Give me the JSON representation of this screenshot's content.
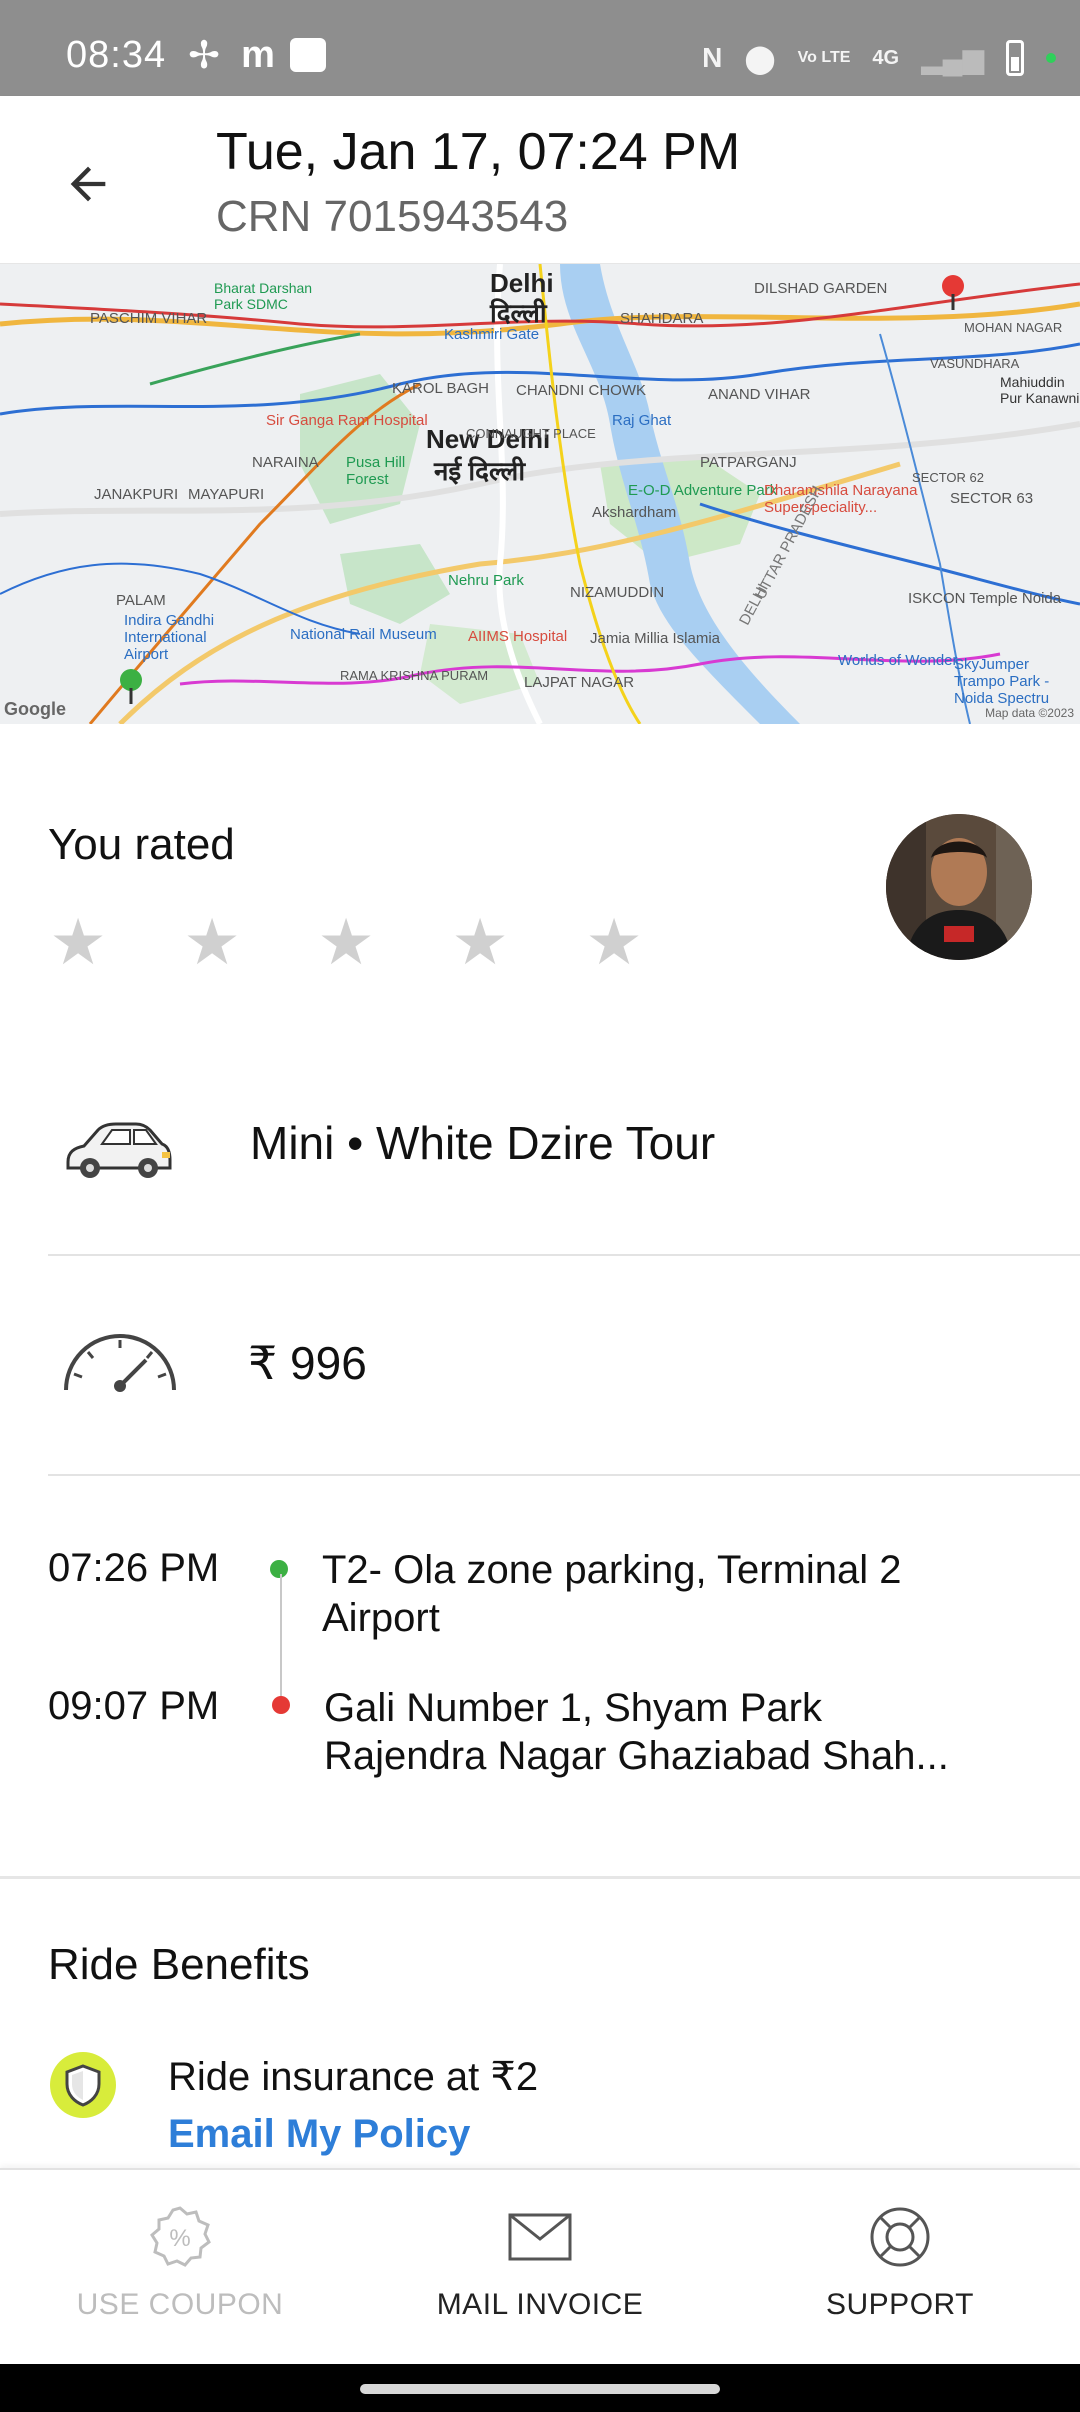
{
  "status_bar": {
    "time": "08:34",
    "signal_label": "4G",
    "volte_label": "Vo LTE"
  },
  "header": {
    "title": "Tue, Jan 17, 07:24 PM",
    "crn": "CRN 7015943543"
  },
  "map": {
    "labels": {
      "delhi_en": "Delhi",
      "delhi_hi": "दिल्ली",
      "new_delhi_en": "New Delhi",
      "new_delhi_hi": "नई दिल्ली",
      "paschim_vihar": "PASCHIM VIHAR",
      "shahdara": "SHAHDARA",
      "dilshad_garden": "DILSHAD GARDEN",
      "karol_bagh": "KAROL BAGH",
      "chandni_chowk": "CHANDNI CHOWK",
      "connaught_place": "CONNAUGHT PLACE",
      "anand_vihar": "ANAND VIHAR",
      "patparganj": "PATPARGANJ",
      "naraina": "NARAINA",
      "janakpuri": "JANAKPURI",
      "mayapuri": "MAYAPURI",
      "palam": "PALAM",
      "nizamuddin": "NIZAMUDDIN",
      "lajpat_nagar": "LAJPAT NAGAR",
      "rama_krishna_puram": "RAMA KRISHNA PURAM",
      "sector_62": "SECTOR 62",
      "sector_63": "SECTOR 63",
      "mohan_nagar": "MOHAN NAGAR",
      "vasundhara": "VASUNDHARA",
      "mahiuddin": "Mahiuddin Pur Kanawni",
      "bharat_darshan": "Bharat Darshan Park SDMC",
      "kashmiri_gate": "Kashmiri Gate",
      "raj_ghat": "Raj Ghat",
      "sir_ganga_ram": "Sir Ganga Ram Hospital",
      "pusa_hill": "Pusa Hill Forest",
      "akshardham": "Akshardham",
      "eod_park": "E-O-D Adventure Park",
      "dharamshila": "Dharamshila Narayana Superspeciality...",
      "nehru_park": "Nehru Park",
      "national_rail_museum": "National Rail Museum",
      "aiims": "AIIMS Hospital",
      "jamia": "Jamia Millia Islamia",
      "iskcon": "ISKCON Temple Noida",
      "worlds_of_wonder": "Worlds of Wonder",
      "skyjumper": "SkyJumper Trampo Park - Noida Spectru",
      "igi_airport": "Indira Gandhi International Airport",
      "uttar_pradesh": "UTTAR PRADESH",
      "delhi_state": "DELHI",
      "google": "Google",
      "copyright": "Map data ©2023"
    }
  },
  "rating": {
    "title": "You rated",
    "stars": 0,
    "max_stars": 5
  },
  "ride": {
    "car_info": "Mini • White Dzire Tour",
    "fare": "₹ 996"
  },
  "trip": {
    "pickup_time": "07:26 PM",
    "pickup_line1": "T2- Ola zone parking, Terminal 2",
    "pickup_line2": "Airport",
    "drop_time": "09:07 PM",
    "drop_line1": "Gali Number 1, Shyam Park",
    "drop_line2": "Rajendra Nagar Ghaziabad Shah...",
    "pickup_color": "#3cb043",
    "drop_color": "#e53935"
  },
  "benefits": {
    "title": "Ride Benefits",
    "insurance_text": "Ride insurance at ₹2",
    "policy_link": "Email My Policy",
    "link_color": "#2e7ed8"
  },
  "bottom_bar": {
    "coupon_label": "USE COUPON",
    "invoice_label": "MAIL INVOICE",
    "support_label": "SUPPORT"
  }
}
